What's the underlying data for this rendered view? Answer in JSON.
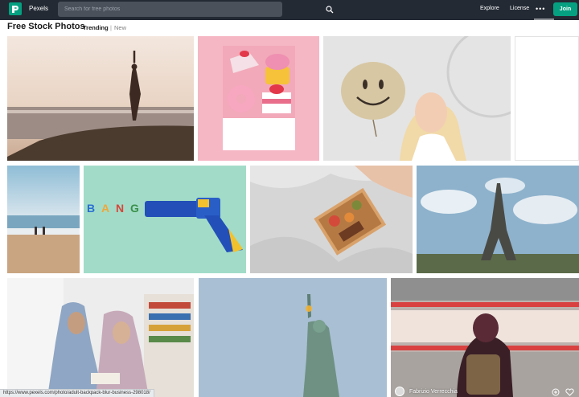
{
  "header": {
    "brand": "Pexels",
    "search_placeholder": "Search for free photos",
    "nav": [
      "Explore",
      "License"
    ],
    "more": "•••",
    "join_label": "Join"
  },
  "heading": {
    "title": "Free Stock Photos",
    "tab_trending": "Trending",
    "separator": "|",
    "tab_new": "New"
  },
  "footer": {
    "status_url": "https://www.pexels.com/photo/adult-backpack-blur-business-298018/",
    "photographer": "Fabrizio Verrecchia"
  },
  "colors": {
    "topbar": "#232a34",
    "brand_green": "#05a081"
  },
  "photos": [
    {
      "name": "photo-yoga-sunset"
    },
    {
      "name": "photo-pastel-desserts"
    },
    {
      "name": "photo-smiley-balloon"
    },
    {
      "name": "photo-blank-placeholder"
    },
    {
      "name": "photo-beach-walk"
    },
    {
      "name": "photo-toy-gun-bang"
    },
    {
      "name": "photo-breakfast-in-bed"
    },
    {
      "name": "photo-eiffel-tower"
    },
    {
      "name": "photo-two-women-reading"
    },
    {
      "name": "photo-statue-of-liberty"
    },
    {
      "name": "photo-subway-backpack"
    }
  ]
}
